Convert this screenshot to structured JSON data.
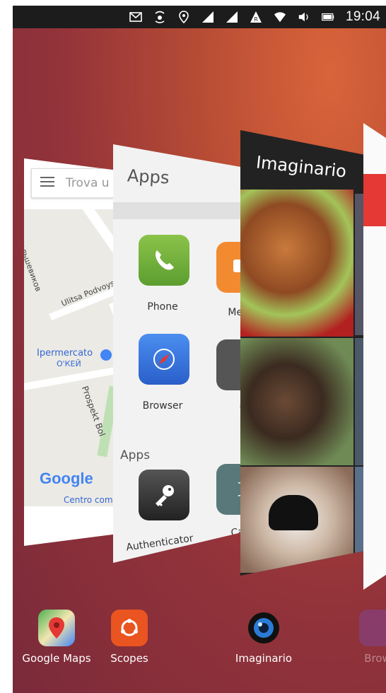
{
  "status_bar": {
    "time": "19:04",
    "icons": [
      "mail-icon",
      "alarm-icon",
      "location-icon",
      "signal-icon",
      "signal-icon",
      "roaming-icon",
      "wifi-icon",
      "volume-icon",
      "battery-icon"
    ]
  },
  "cards": {
    "maps": {
      "search_placeholder": "Trova u",
      "labels": [
        "Большевиков",
        "Ulitsa Podvoysko",
        "Ipermercato",
        "О'КЕЙ",
        "Prospekt Bol",
        "Centro comm"
      ],
      "brand": "Google"
    },
    "apps": {
      "title": "Apps",
      "apps": [
        {
          "label": "Phone",
          "icon": "phone-icon"
        },
        {
          "label": "Mess",
          "icon": "messaging-icon"
        },
        {
          "label": "Browser",
          "icon": "browser-icon"
        },
        {
          "label": "Clo",
          "icon": "clock-icon"
        },
        {
          "label": "Authenticator",
          "icon": "key-icon"
        },
        {
          "label": "Calcu",
          "icon": "calculator-icon"
        }
      ],
      "section_label": "Apps"
    },
    "imaginario": {
      "title": "Imaginario"
    }
  },
  "dock": [
    {
      "label": "Google Maps",
      "icon": "google-maps-icon"
    },
    {
      "label": "Scopes",
      "icon": "scopes-icon"
    },
    {
      "label": "Imaginario",
      "icon": "imaginario-icon"
    },
    {
      "label": "Brow",
      "icon": "browser-icon"
    }
  ],
  "colors": {
    "accent": "#e95420",
    "status_bar": "#1c1c1c"
  }
}
